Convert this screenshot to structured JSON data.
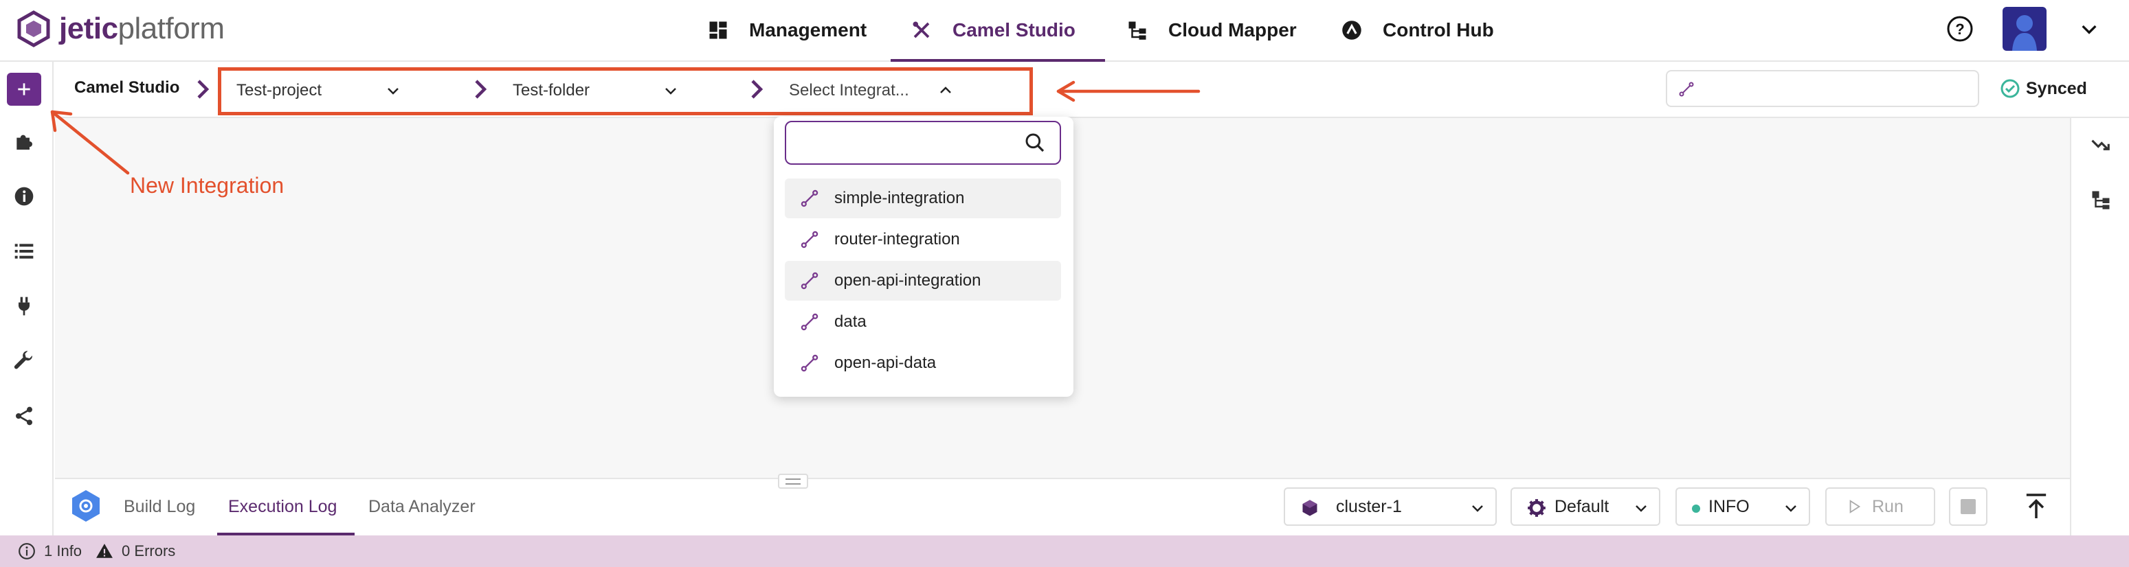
{
  "brand": {
    "bold": "jetic",
    "light": "platform"
  },
  "nav": {
    "items": [
      {
        "label": "Management",
        "icon": "dashboard-icon"
      },
      {
        "label": "Camel Studio",
        "icon": "tools-icon",
        "active": true
      },
      {
        "label": "Cloud Mapper",
        "icon": "hierarchy-icon"
      },
      {
        "label": "Control Hub",
        "icon": "hub-icon"
      }
    ]
  },
  "breadcrumb": {
    "root": "Camel Studio",
    "project": "Test-project",
    "folder": "Test-folder",
    "integration_placeholder": "Select Integrat..."
  },
  "sync_status": "Synced",
  "dropdown": {
    "search_value": "",
    "items": [
      "simple-integration",
      "router-integration",
      "open-api-integration",
      "data",
      "open-api-data"
    ]
  },
  "annotation": {
    "label": "New Integration",
    "color": "#e3512d"
  },
  "bottom": {
    "tabs": [
      "Build Log",
      "Execution Log",
      "Data Analyzer"
    ],
    "active_tab": "Execution Log",
    "cluster": "cluster-1",
    "profile": "Default",
    "log_level": "INFO",
    "run_label": "Run"
  },
  "status": {
    "info": "1 Info",
    "errors": "0 Errors"
  },
  "colors": {
    "accent": "#5b2a6e",
    "highlight": "#e3512d",
    "status_bar": "#e5cfe2"
  }
}
